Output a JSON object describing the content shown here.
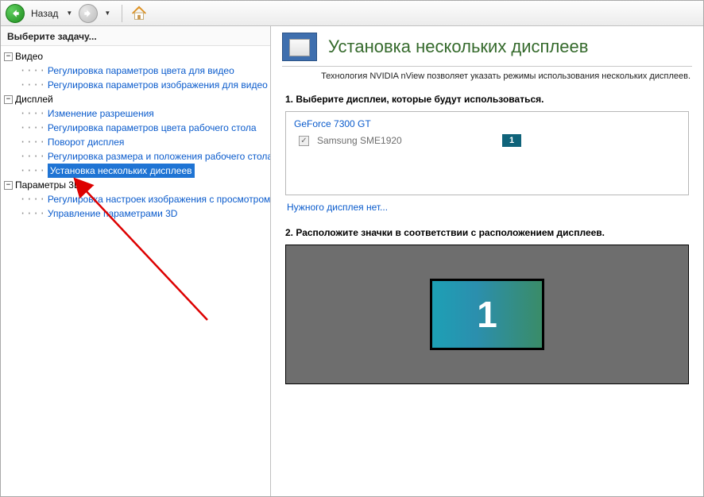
{
  "toolbar": {
    "back_label": "Назад"
  },
  "sidebar": {
    "header": "Выберите задачу...",
    "groups": [
      {
        "label": "Видео",
        "items": [
          "Регулировка параметров цвета для видео",
          "Регулировка параметров изображения для видео"
        ]
      },
      {
        "label": "Дисплей",
        "items": [
          "Изменение разрешения",
          "Регулировка параметров цвета рабочего стола",
          "Поворот дисплея",
          "Регулировка размера и положения рабочего стола",
          "Установка нескольких дисплеев"
        ],
        "selected_index": 4
      },
      {
        "label": "Параметры 3D",
        "items": [
          "Регулировка настроек изображения с просмотром",
          "Управление параметрами 3D"
        ]
      }
    ]
  },
  "content": {
    "title": "Установка нескольких дисплеев",
    "description": "Технология NVIDIA nView позволяет указать режимы использования нескольких дисплеев.",
    "step1_title": "1. Выберите дисплеи, которые будут использоваться.",
    "gpu": "GeForce 7300 GT",
    "display_name": "Samsung SME1920",
    "display_badge": "1",
    "missing_link": "Нужного дисплея нет...",
    "step2_title": "2. Расположите значки в соответствии с расположением дисплеев.",
    "monitor_label": "1"
  }
}
